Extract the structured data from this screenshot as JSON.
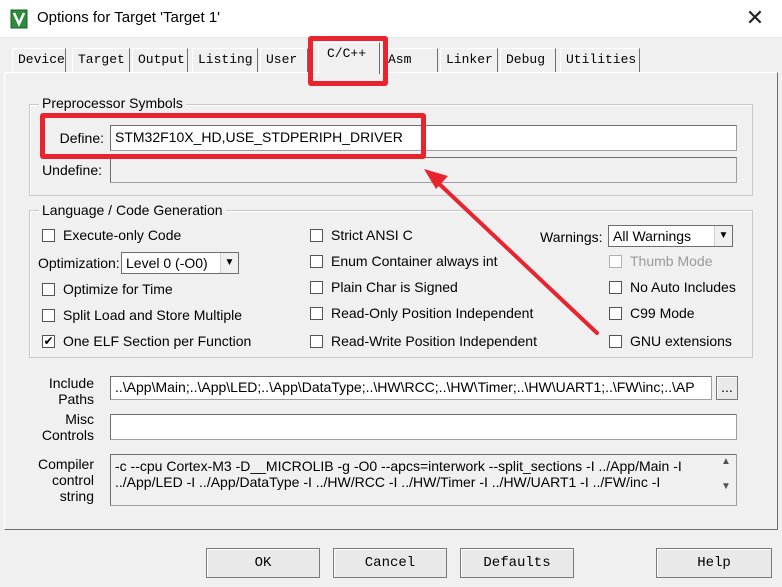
{
  "window": {
    "title": "Options for Target 'Target 1'",
    "close_glyph": "✕"
  },
  "tabs": [
    "Device",
    "Target",
    "Output",
    "Listing",
    "User",
    "C/C++",
    "Asm",
    "Linker",
    "Debug",
    "Utilities"
  ],
  "active_tab": "C/C++",
  "preprocessor": {
    "group_label": "Preprocessor Symbols",
    "define_label": "Define:",
    "define_value": "STM32F10X_HD,USE_STDPERIPH_DRIVER",
    "undefine_label": "Undefine:",
    "undefine_value": ""
  },
  "language": {
    "group_label": "Language / Code Generation",
    "execute_only": {
      "label": "Execute-only Code",
      "checked": false
    },
    "optimization_label": "Optimization:",
    "optimization_value": "Level 0 (-O0)",
    "optimize_for_time": {
      "label": "Optimize for Time",
      "checked": false
    },
    "split_load_store": {
      "label": "Split Load and Store Multiple",
      "checked": false
    },
    "one_elf_section": {
      "label": "One ELF Section per Function",
      "checked": true
    },
    "strict_ansi": {
      "label": "Strict ANSI C",
      "checked": false
    },
    "enum_container": {
      "label": "Enum Container always int",
      "checked": false
    },
    "plain_char_signed": {
      "label": "Plain Char is Signed",
      "checked": false
    },
    "ro_pos_indep": {
      "label": "Read-Only Position Independent",
      "checked": false
    },
    "rw_pos_indep": {
      "label": "Read-Write Position Independent",
      "checked": false
    },
    "warnings_label": "Warnings:",
    "warnings_value": "All Warnings",
    "thumb_mode": {
      "label": "Thumb Mode",
      "checked": false
    },
    "no_auto_includes": {
      "label": "No Auto Includes",
      "checked": false
    },
    "c99_mode": {
      "label": "C99 Mode",
      "checked": false
    },
    "gnu_extensions": {
      "label": "GNU extensions",
      "checked": false
    }
  },
  "paths": {
    "include_label_1": "Include",
    "include_label_2": "Paths",
    "include_value": "..\\App\\Main;..\\App\\LED;..\\App\\DataType;..\\HW\\RCC;..\\HW\\Timer;..\\HW\\UART1;..\\FW\\inc;..\\AP",
    "browse_label": "...",
    "misc_label_1": "Misc",
    "misc_label_2": "Controls",
    "misc_value": "",
    "compiler_label_1": "Compiler",
    "compiler_label_2": "control",
    "compiler_label_3": "string",
    "compiler_line_1": "-c --cpu Cortex-M3 -D__MICROLIB -g -O0 --apcs=interwork --split_sections -I ../App/Main -I",
    "compiler_line_2": "../App/LED -I ../App/DataType -I ../HW/RCC -I ../HW/Timer -I ../HW/UART1 -I ../FW/inc -I"
  },
  "buttons": {
    "ok": "OK",
    "cancel": "Cancel",
    "defaults": "Defaults",
    "help": "Help"
  },
  "colors": {
    "annotation_red": "#e8242f",
    "icon_green": "#2e8b3d"
  }
}
